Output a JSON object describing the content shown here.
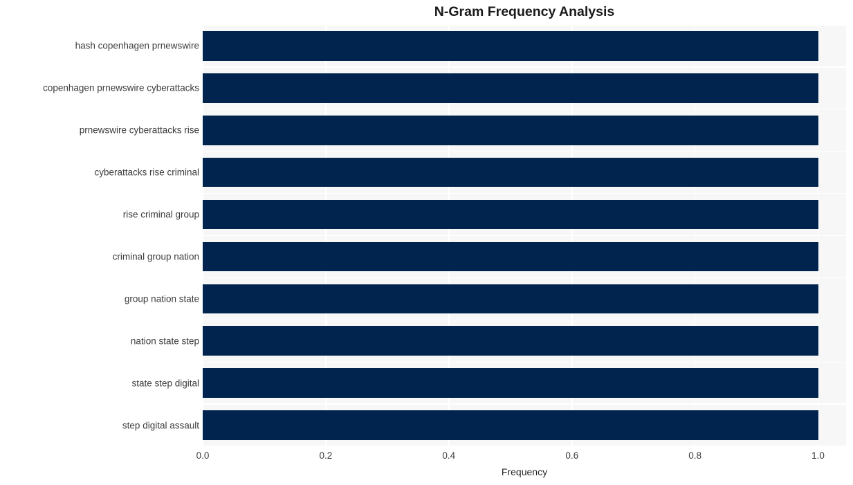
{
  "chart_data": {
    "type": "bar",
    "orientation": "horizontal",
    "title": "N-Gram Frequency Analysis",
    "xlabel": "Frequency",
    "ylabel": "",
    "categories": [
      "hash copenhagen prnewswire",
      "copenhagen prnewswire cyberattacks",
      "prnewswire cyberattacks rise",
      "cyberattacks rise criminal",
      "rise criminal group",
      "criminal group nation",
      "group nation state",
      "nation state step",
      "state step digital",
      "step digital assault"
    ],
    "values": [
      1.0,
      1.0,
      1.0,
      1.0,
      1.0,
      1.0,
      1.0,
      1.0,
      1.0,
      1.0
    ],
    "xlim": [
      0.0,
      1.0455
    ],
    "xticks": [
      0.0,
      0.2,
      0.4,
      0.6,
      0.8,
      1.0
    ],
    "xtick_labels": [
      "0.0",
      "0.2",
      "0.4",
      "0.6",
      "0.8",
      "1.0"
    ],
    "grid": true,
    "legend": null,
    "bar_color": "#00244e",
    "plot_background": "#f7f7f7",
    "figure_background": "#ffffff",
    "gridline_color": "#ffffff"
  }
}
